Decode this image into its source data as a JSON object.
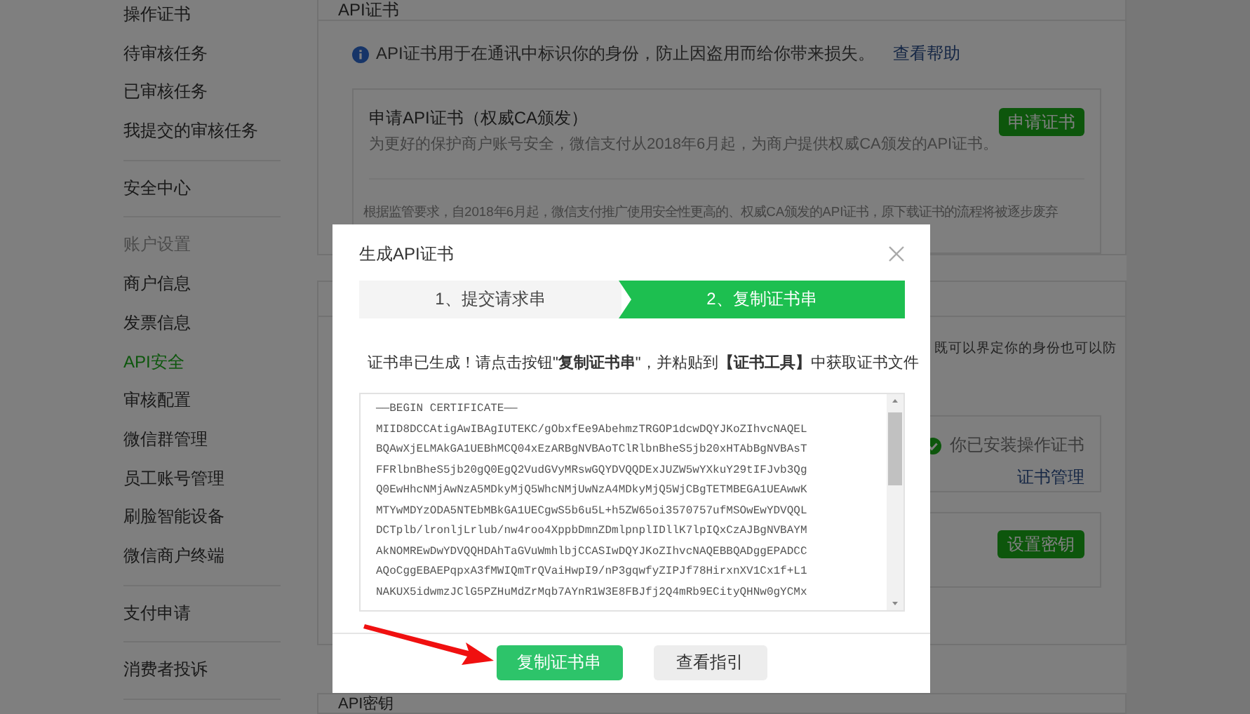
{
  "sidebar": {
    "groups": [
      {
        "items": [
          {
            "label": "操作证书",
            "kind": "item",
            "selected": false
          },
          {
            "label": "待审核任务",
            "kind": "item",
            "selected": false
          },
          {
            "label": "已审核任务",
            "kind": "item",
            "selected": false
          },
          {
            "label": "我提交的审核任务",
            "kind": "item",
            "selected": false
          }
        ]
      },
      {
        "items": [
          {
            "label": "安全中心",
            "kind": "item",
            "selected": false
          }
        ]
      },
      {
        "items": [
          {
            "label": "账户设置",
            "kind": "header",
            "selected": false
          },
          {
            "label": "商户信息",
            "kind": "item",
            "selected": false
          },
          {
            "label": "发票信息",
            "kind": "item",
            "selected": false
          },
          {
            "label": "API安全",
            "kind": "item",
            "selected": true
          },
          {
            "label": "审核配置",
            "kind": "item",
            "selected": false
          },
          {
            "label": "微信群管理",
            "kind": "item",
            "selected": false
          },
          {
            "label": "员工账号管理",
            "kind": "item",
            "selected": false
          },
          {
            "label": "刷脸智能设备",
            "kind": "item",
            "selected": false
          },
          {
            "label": "微信商户终端",
            "kind": "item",
            "selected": false
          }
        ]
      },
      {
        "items": [
          {
            "label": "支付申请",
            "kind": "item",
            "selected": false
          }
        ]
      },
      {
        "items": [
          {
            "label": "消费者投诉",
            "kind": "item",
            "selected": false
          }
        ]
      }
    ]
  },
  "api_certificate_panel": {
    "title": "API证书",
    "notice": "API证书用于在通讯中标识你的身份，防止因盗用而给你带来损失。",
    "help_link": "查看帮助",
    "apply_card": {
      "title": "申请API证书（权威CA颁发）",
      "description": "为更好的保护商户账号安全，微信支付从2018年6月起，为商户提供权威CA颁发的API证书。",
      "button": "申请证书"
    },
    "policy_text": "根据监管要求，自2018年6月起，微信支付推广使用安全性更高的、权威CA颁发的API证书，原下载证书的流程将被逐步废弃"
  },
  "operation_certificate_panel": {
    "description": "既可以界定你的身份也可以防",
    "status": "你已安装操作证书",
    "manage_link": "证书管理",
    "key_button": "设置密钥"
  },
  "api_key_panel": {
    "title": "API密钥"
  },
  "dialog": {
    "title": "生成API证书",
    "steps": [
      {
        "label": "1、提交请求串",
        "selected": false
      },
      {
        "label": "2、复制证书串",
        "selected": true
      }
    ],
    "success_message": "证书串已生成！请点击按钮\"**复制证书串**\"，并粘贴到**【证书工具】**中获取证书文件",
    "certificate_lines": [
      "——BEGIN CERTIFICATE——",
      "MIID8DCCAtigAwIBAgIUTEKC/gObxfEe9AbehmzTRGOP1dcwDQYJKoZIhvcNAQEL",
      "BQAwXjELMAkGA1UEBhMCQ04xEzARBgNVBAoTClRlbnBheS5jb20xHTAbBgNVBAsT",
      "FFRlbnBheS5jb20gQ0EgQ2VudGVyMRswGQYDVQQDExJUZW5wYXkuY29tIFJvb3Qg",
      "Q0EwHhcNMjAwNzA5MDkyMjQ5WhcNMjUwNzA4MDkyMjQ5WjCBgTETMBEGA1UEAwwK",
      "MTYwMDYzODA5NTEbMBkGA1UECgwS5b6u5L+h5ZW65oi3570757ufMSOwEwYDVQQL",
      "DCTplb/lronljLrlub/nw4roo4XppbDmnZDmlpnplIDllK7lpIQxCzAJBgNVBAYM",
      "AkNOMREwDwYDVQQHDAhTaGVuWmhlbjCCASIwDQYJKoZIhvcNAQEBBQADggEPADCC",
      "AQoCggEBAEPqpxA3fMWIQmTrQVaiHwpI9/nP3gqwfyZIPJf78HirxnXV1Cx1f+L1",
      "NAKUX5idwmzJClG5PZHuMdZrMqb7AYnR1W3E8FBJfj2Q4mRb9ECityQHNw0gYCMx"
    ],
    "buttons": [
      {
        "label": "复制证书串",
        "kind": "primary"
      },
      {
        "label": "查看指引",
        "kind": "secondary"
      }
    ]
  }
}
